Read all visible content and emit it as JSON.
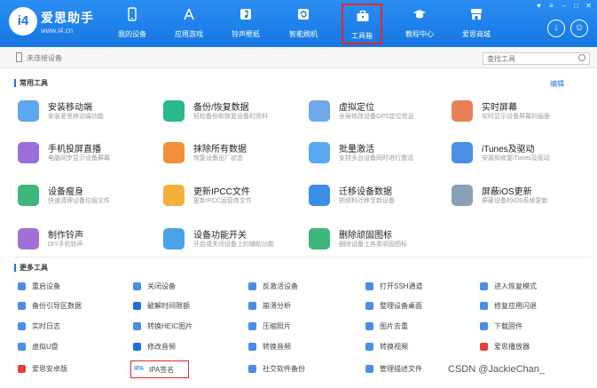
{
  "header": {
    "brand": "爱思助手",
    "url": "www.i4.cn",
    "logo_text": "i4",
    "nav": [
      {
        "label": "我的设备",
        "icon": "phone-icon"
      },
      {
        "label": "应用游戏",
        "icon": "app-store-icon"
      },
      {
        "label": "铃声壁纸",
        "icon": "music-icon"
      },
      {
        "label": "智能刷机",
        "icon": "flash-icon"
      },
      {
        "label": "工具箱",
        "icon": "toolbox-icon",
        "active": true
      },
      {
        "label": "教程中心",
        "icon": "graduation-icon"
      },
      {
        "label": "爱思商城",
        "icon": "store-icon"
      }
    ]
  },
  "subbar": {
    "device_status": "未连接设备",
    "search_placeholder": "查找工具"
  },
  "common": {
    "title": "常用工具",
    "edit": "编辑",
    "tools": [
      {
        "title": "安装移动端",
        "desc": "安装爱思移动端功能",
        "color": "#5aa9ee"
      },
      {
        "title": "备份/恢复数据",
        "desc": "轻松备份和恢复设备的资料",
        "color": "#28b98e"
      },
      {
        "title": "虚拟定位",
        "desc": "全局修改设备GPS定位信息",
        "color": "#6fa8e8"
      },
      {
        "title": "实时屏幕",
        "desc": "实时显示设备屏幕的画面",
        "color": "#e8805a"
      },
      {
        "title": "手机投屏直播",
        "desc": "电脑同步显示设备屏幕",
        "color": "#9b6fd9"
      },
      {
        "title": "抹除所有数据",
        "desc": "恢复设备出厂状态",
        "color": "#f28f3b"
      },
      {
        "title": "批量激活",
        "desc": "支持多台设备同时进行激活",
        "color": "#5aa9ee"
      },
      {
        "title": "iTunes及驱动",
        "desc": "安装和修复iTunes及驱动",
        "color": "#4a8ee8"
      },
      {
        "title": "设备瘦身",
        "desc": "快速清理设备垃圾文件",
        "color": "#3fb67a"
      },
      {
        "title": "更新IPCC文件",
        "desc": "更新IPCC运营商文件",
        "color": "#f2b03b"
      },
      {
        "title": "迁移设备数据",
        "desc": "把资料迁移至新设备",
        "color": "#3b8de8"
      },
      {
        "title": "屏蔽iOS更新",
        "desc": "屏蔽设备的iOS系统更新",
        "color": "#8aa0b8"
      },
      {
        "title": "制作铃声",
        "desc": "DIY手机铃声",
        "color": "#a26fd9"
      },
      {
        "title": "设备功能开关",
        "desc": "开启或关闭设备上的辅助功能",
        "color": "#4aa3e8"
      },
      {
        "title": "删除顽固图标",
        "desc": "删除设备上各类顽固图标",
        "color": "#3fb67a"
      }
    ]
  },
  "more": {
    "title": "更多工具",
    "tools": [
      {
        "label": "重启设备",
        "color": "#4a8ee8"
      },
      {
        "label": "关闭设备",
        "color": "#4a8ee8"
      },
      {
        "label": "反激活设备",
        "color": "#4a8ee8"
      },
      {
        "label": "打开SSH通道",
        "color": "#4a8ee8"
      },
      {
        "label": "进入恢复模式",
        "color": "#4a8ee8"
      },
      {
        "label": "备份引导区数据",
        "color": "#4a8ee8"
      },
      {
        "label": "破解时间限额",
        "color": "#1f6fd9"
      },
      {
        "label": "崩溃分析",
        "color": "#4a8ee8"
      },
      {
        "label": "整理设备桌面",
        "color": "#4a8ee8"
      },
      {
        "label": "修复应用闪退",
        "color": "#4a8ee8"
      },
      {
        "label": "实时日志",
        "color": "#4a8ee8"
      },
      {
        "label": "转换HEIC图片",
        "color": "#4a8ee8"
      },
      {
        "label": "压缩照片",
        "color": "#4a8ee8"
      },
      {
        "label": "图片去重",
        "color": "#4a8ee8"
      },
      {
        "label": "下载固件",
        "color": "#4a8ee8"
      },
      {
        "label": "虚拟U盘",
        "color": "#4a8ee8"
      },
      {
        "label": "修改音频",
        "color": "#1f6fd9"
      },
      {
        "label": "转换音频",
        "color": "#4a8ee8"
      },
      {
        "label": "转换视频",
        "color": "#4a8ee8"
      },
      {
        "label": "爱思播放器",
        "color": "#e0403a"
      },
      {
        "label": "爱思安卓版",
        "color": "#e0403a"
      },
      {
        "label": "IPA签名",
        "color": "#4a8ee8",
        "highlight": true,
        "icon_text": "IPA"
      },
      {
        "label": "社交软件备份",
        "color": "#4a8ee8"
      },
      {
        "label": "管理描述文件",
        "color": "#4a8ee8"
      },
      {
        "label": "",
        "color": "#4a8ee8"
      }
    ]
  },
  "watermark": "CSDN @JackieChan_"
}
